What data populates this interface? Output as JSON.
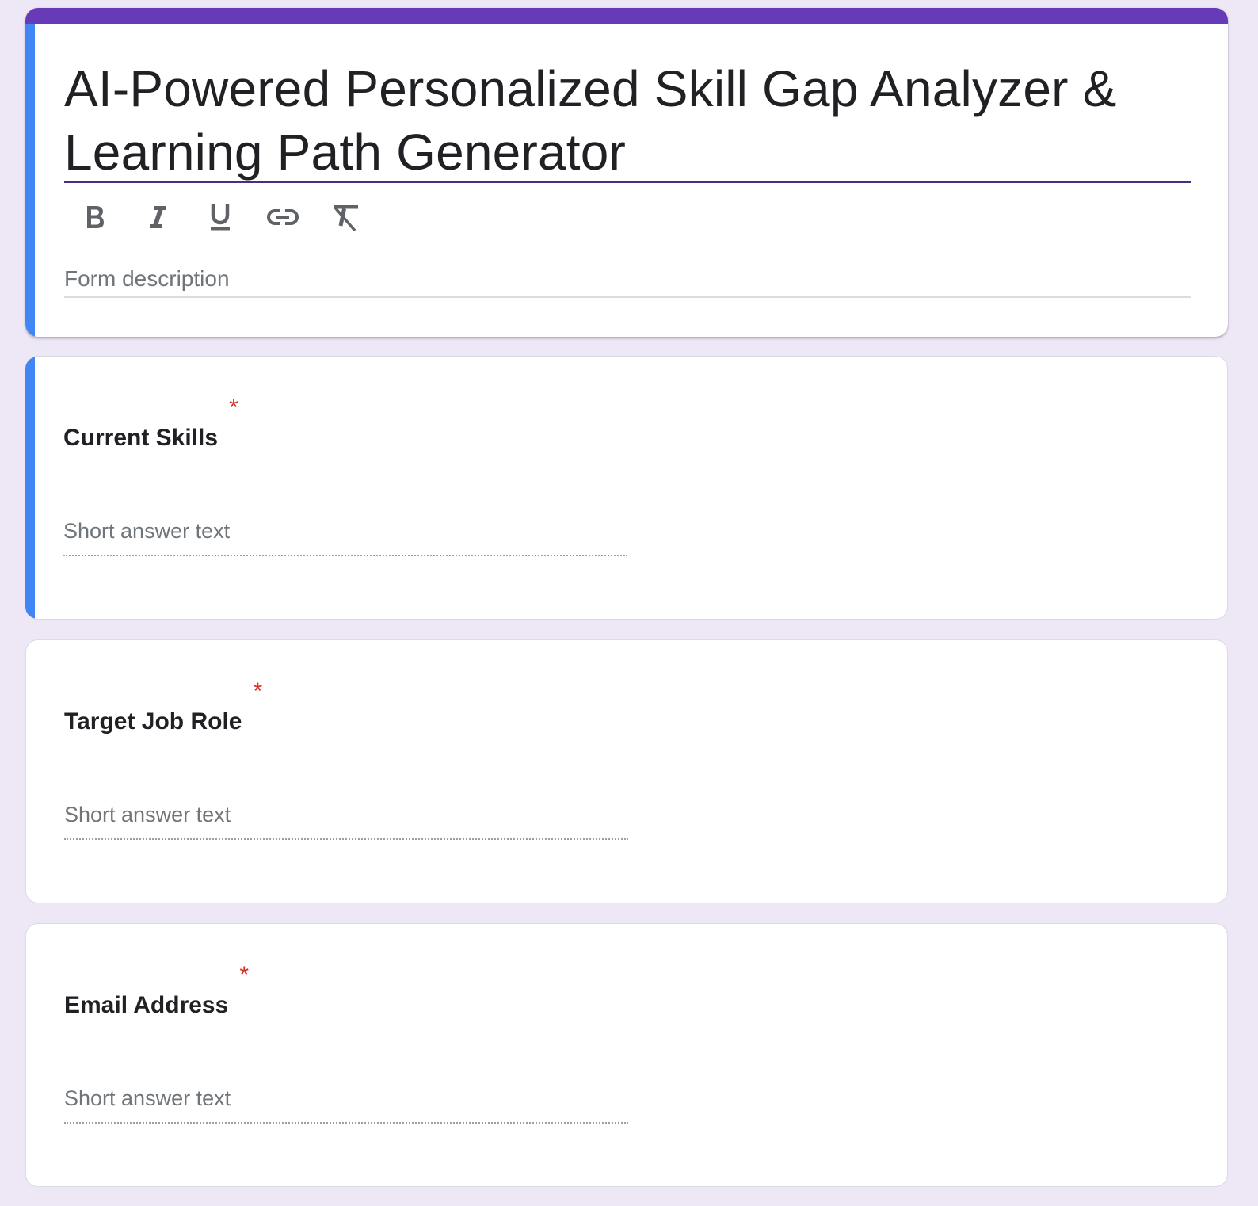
{
  "form": {
    "title": "AI-Powered Personalized Skill Gap Analyzer & Learning Path Generator",
    "description_placeholder": "Form description",
    "toolbar": [
      "bold-icon",
      "italic-icon",
      "underline-icon",
      "link-icon",
      "clear-formatting-icon"
    ],
    "colors": {
      "theme": "#673ab7",
      "active_accent": "#4285f4",
      "background": "#ede7f6",
      "required": "#d93025"
    }
  },
  "questions": [
    {
      "title": "Current Skills",
      "required_mark": "*",
      "answer_placeholder": "Short answer text"
    },
    {
      "title": "Target Job Role",
      "required_mark": "*",
      "answer_placeholder": "Short answer text"
    },
    {
      "title": "Email Address",
      "required_mark": "*",
      "answer_placeholder": "Short answer text"
    }
  ]
}
